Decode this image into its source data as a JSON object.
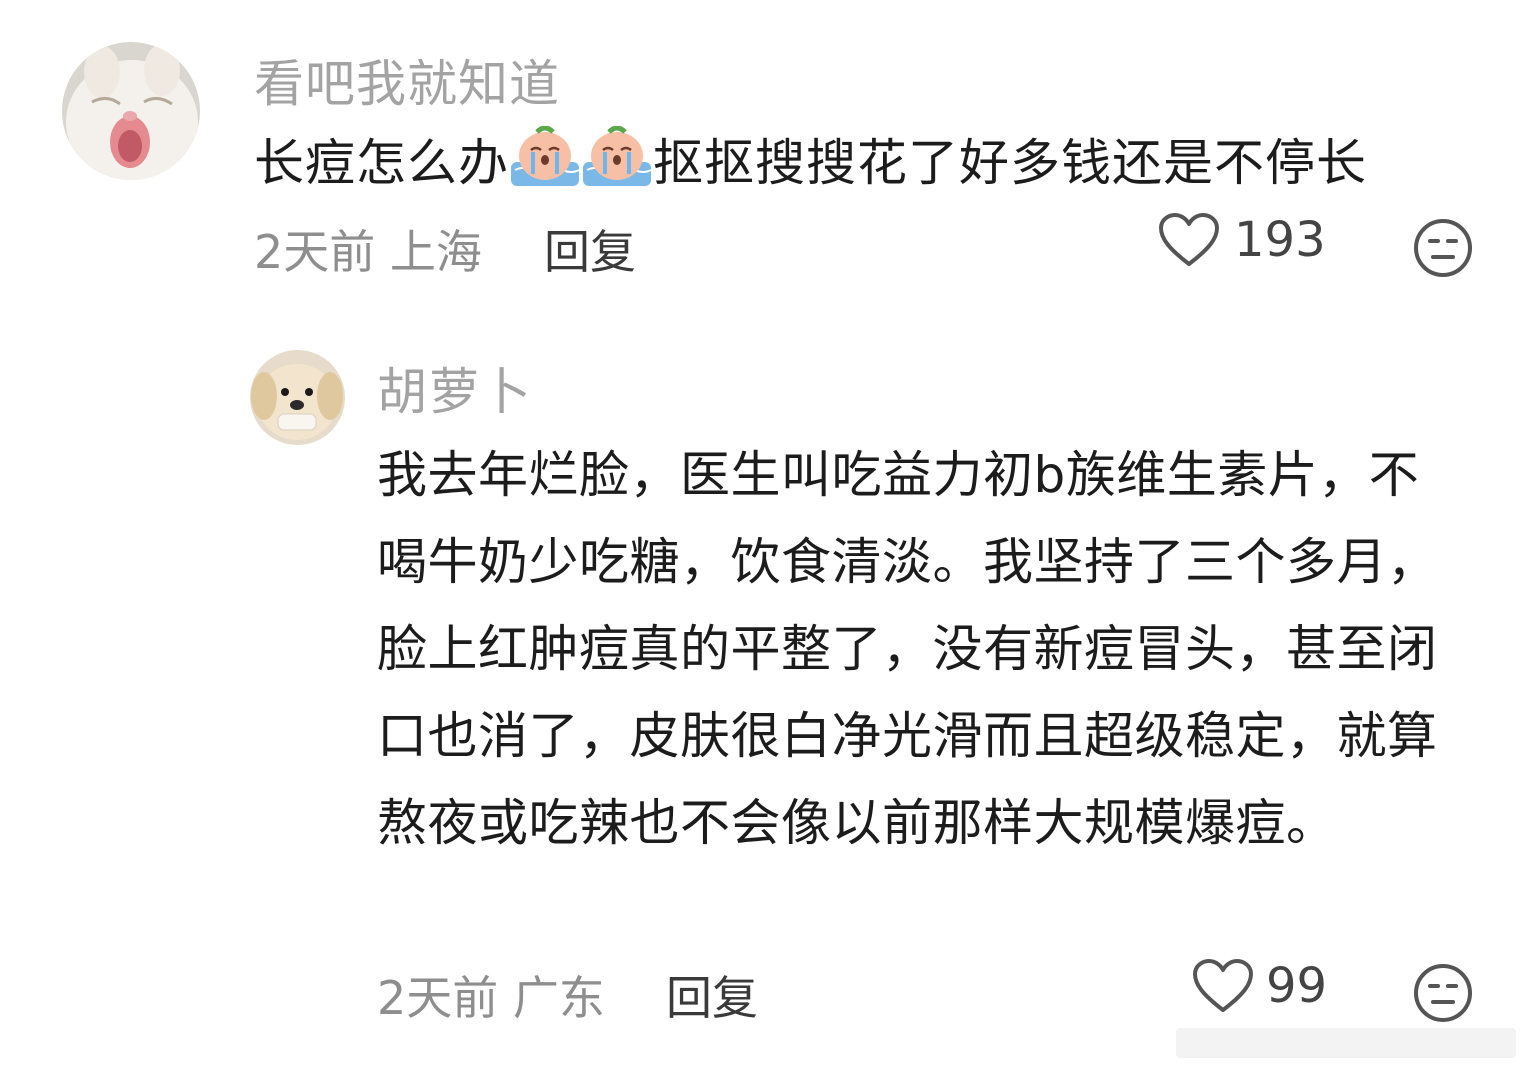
{
  "comments": [
    {
      "username": "看吧我就知道",
      "text_before_emoji": "长痘怎么办",
      "inline_emojis": [
        "crying-face-emoji",
        "crying-face-emoji"
      ],
      "text_after_emoji": "抠抠搜搜花了好多钱还是不停长",
      "meta": "2天前 上海",
      "reply_label": "回复",
      "like_count": "193",
      "avatar_icon": "white-cat-yawning-avatar"
    },
    {
      "username": "胡萝卜",
      "text": "我去年烂脸，医生叫吃益力初b族维生素片，不喝牛奶少吃糖，饮食清淡。我坚持了三个多月，脸上红肿痘真的平整了，没有新痘冒头，甚至闭口也消了，皮肤很白净光滑而且超级稳定，就算熬夜或吃辣也不会像以前那样大规模爆痘。",
      "meta": "2天前 广东",
      "reply_label": "回复",
      "like_count": "99",
      "avatar_icon": "golden-puppy-avatar"
    }
  ],
  "colors": {
    "username": "#a3a3a3",
    "body_text": "#1c1c1c",
    "meta": "#8e8e8e",
    "icon": "#555555"
  }
}
